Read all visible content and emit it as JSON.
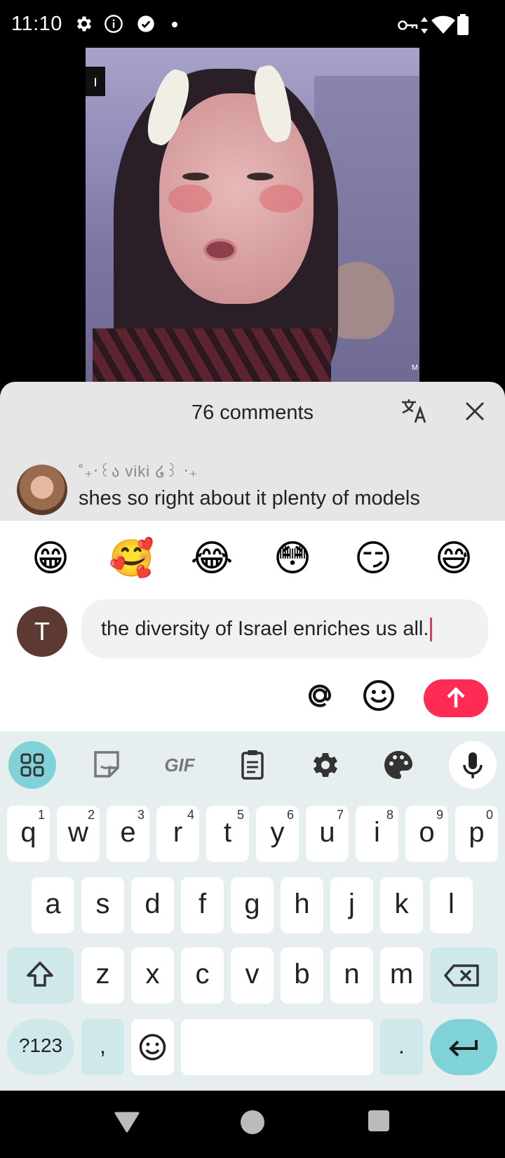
{
  "status_bar": {
    "time": "11:10"
  },
  "video": {
    "corner_tag": "ı",
    "watermark": "M"
  },
  "comments": {
    "title": "76 comments",
    "first_comment": {
      "username": "˚₊‧꒰ა viki ໒꒱ ‧₊",
      "text": "shes so right about it plenty of models"
    }
  },
  "quick_emojis": [
    "😁",
    "🥰",
    "😂",
    "😳",
    "😏",
    "😅"
  ],
  "composer": {
    "avatar_letter": "T",
    "input_value": "the diversity of Israel enriches us all.",
    "accent_color": "#fe2c55"
  },
  "keyboard": {
    "toolbar": {
      "gif_label": "GIF"
    },
    "row1": [
      {
        "k": "q",
        "n": "1"
      },
      {
        "k": "w",
        "n": "2"
      },
      {
        "k": "e",
        "n": "3"
      },
      {
        "k": "r",
        "n": "4"
      },
      {
        "k": "t",
        "n": "5"
      },
      {
        "k": "y",
        "n": "6"
      },
      {
        "k": "u",
        "n": "7"
      },
      {
        "k": "i",
        "n": "8"
      },
      {
        "k": "o",
        "n": "9"
      },
      {
        "k": "p",
        "n": "0"
      }
    ],
    "row2": [
      "a",
      "s",
      "d",
      "f",
      "g",
      "h",
      "j",
      "k",
      "l"
    ],
    "row3": [
      "z",
      "x",
      "c",
      "v",
      "b",
      "n",
      "m"
    ],
    "symbols_label": "?123",
    "comma_label": ",",
    "period_label": "."
  }
}
